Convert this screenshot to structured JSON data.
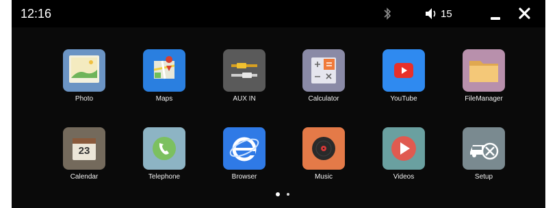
{
  "statusbar": {
    "time": "12:16",
    "volume_level": "15",
    "icons": [
      "bluetooth-icon",
      "volume-icon"
    ],
    "buttons": [
      "minimize-icon",
      "close-icon"
    ]
  },
  "apps": [
    {
      "label": "Photo",
      "icon": "photo-icon",
      "color": "#6b94c4"
    },
    {
      "label": "Maps",
      "icon": "maps-icon",
      "color": "#2a7fe0"
    },
    {
      "label": "AUX IN",
      "icon": "aux-cable-icon",
      "color": "#5a5a5a"
    },
    {
      "label": "Calculator",
      "icon": "calculator-icon",
      "color": "#8a8aa6"
    },
    {
      "label": "YouTube",
      "icon": "youtube-icon",
      "color": "#2f8af0"
    },
    {
      "label": "FileManager",
      "icon": "folder-icon",
      "color": "#b890ac"
    },
    {
      "label": "Calendar",
      "icon": "calendar-icon",
      "color": "#746a5c",
      "badge": "23"
    },
    {
      "label": "Telephone",
      "icon": "phone-icon",
      "color": "#8db4c4"
    },
    {
      "label": "Browser",
      "icon": "browser-icon",
      "color": "#2f7ae6"
    },
    {
      "label": "Music",
      "icon": "music-disc-icon",
      "color": "#e47a48"
    },
    {
      "label": "Videos",
      "icon": "video-play-icon",
      "color": "#6aa0a0"
    },
    {
      "label": "Setup",
      "icon": "settings-car-icon",
      "color": "#7a8a90"
    }
  ],
  "pager": {
    "pages": 2,
    "current": 1
  }
}
